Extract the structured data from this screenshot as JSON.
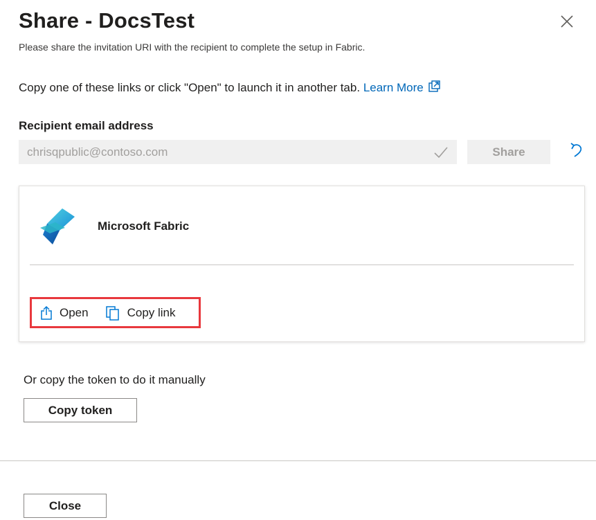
{
  "dialog": {
    "title": "Share - DocsTest",
    "subtitle": "Please share the invitation URI with the recipient to complete the setup in Fabric.",
    "close_icon": "close-icon"
  },
  "instruction": {
    "text": "Copy one of these links or click \"Open\" to launch it in another tab.",
    "link_label": "Learn More",
    "link_icon": "external-link-icon"
  },
  "recipient": {
    "label": "Recipient email address",
    "email_value": "chrisqpublic@contoso.com",
    "validated_icon": "checkmark-icon",
    "share_label": "Share",
    "undo_icon": "undo-icon"
  },
  "card": {
    "logo_icon": "microsoft-fabric-logo-icon",
    "product_name": "Microsoft Fabric",
    "open_label": "Open",
    "open_icon": "share-open-icon",
    "copy_label": "Copy link",
    "copy_icon": "copy-icon",
    "highlight_color": "#e8383d"
  },
  "manual": {
    "text": "Or copy the token to do it manually",
    "copy_token_label": "Copy token"
  },
  "footer": {
    "close_label": "Close"
  },
  "colors": {
    "link": "#0067b8",
    "disabled_bg": "#f0f0f0",
    "disabled_text": "#a19f9d",
    "fabric_blue": "#1e90d6",
    "fabric_teal": "#2bb5c8"
  }
}
